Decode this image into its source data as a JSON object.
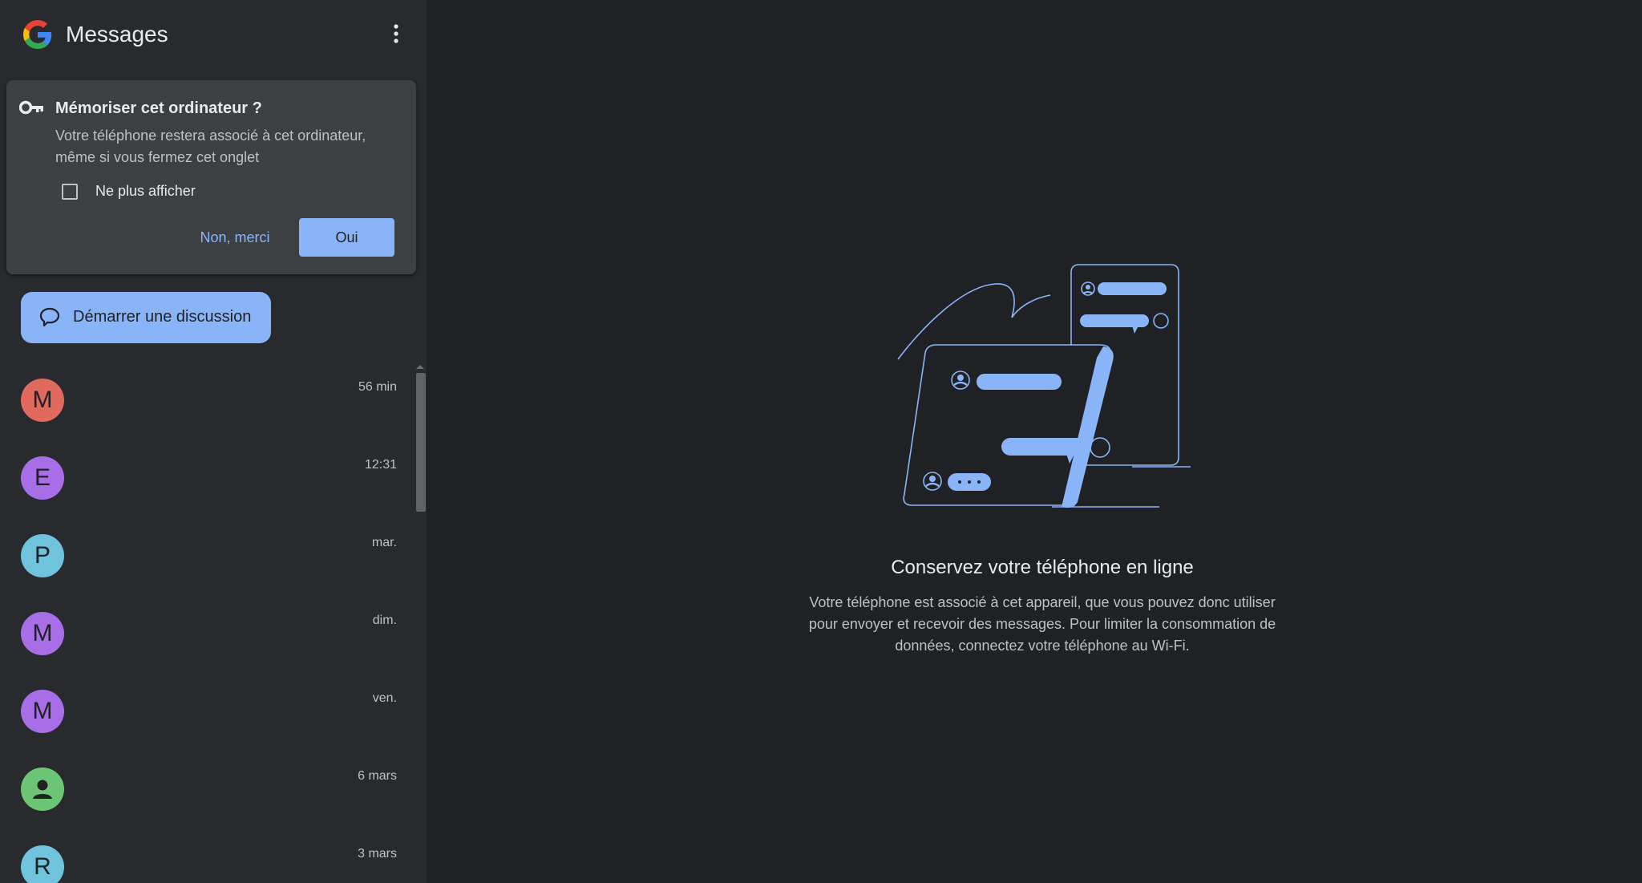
{
  "header": {
    "title": "Messages"
  },
  "prompt": {
    "title": "Mémoriser cet ordinateur ?",
    "body": "Votre téléphone restera associé à cet ordinateur, même si vous fermez cet onglet",
    "checkbox_label": "Ne plus afficher",
    "checkbox_checked": false,
    "no_label": "Non, merci",
    "yes_label": "Oui"
  },
  "start_chat": {
    "label": "Démarrer une discussion"
  },
  "conversations": [
    {
      "initial": "M",
      "time": "56 min",
      "color": "#e06a5e"
    },
    {
      "initial": "E",
      "time": "12:31",
      "color": "#a86ee8"
    },
    {
      "initial": "P",
      "time": "mar.",
      "color": "#6fc3dc"
    },
    {
      "initial": "M",
      "time": "dim.",
      "color": "#a86ee8"
    },
    {
      "initial": "M",
      "time": "ven.",
      "color": "#a86ee8"
    },
    {
      "initial": "",
      "time": "6 mars",
      "color": "#6cc475",
      "icon": "person-icon"
    },
    {
      "initial": "R",
      "time": "3 mars",
      "color": "#6fc3dc"
    }
  ],
  "main": {
    "title": "Conservez votre téléphone en ligne",
    "body": "Votre téléphone est associé à cet appareil, que vous pouvez donc utiliser pour envoyer et recevoir des messages. Pour limiter la consommation de données, connectez votre téléphone au Wi-Fi."
  },
  "colors": {
    "accent": "#8ab4f8",
    "sidebar_bg": "#292a2d",
    "main_bg": "#202124",
    "card_bg": "#3c4043"
  }
}
